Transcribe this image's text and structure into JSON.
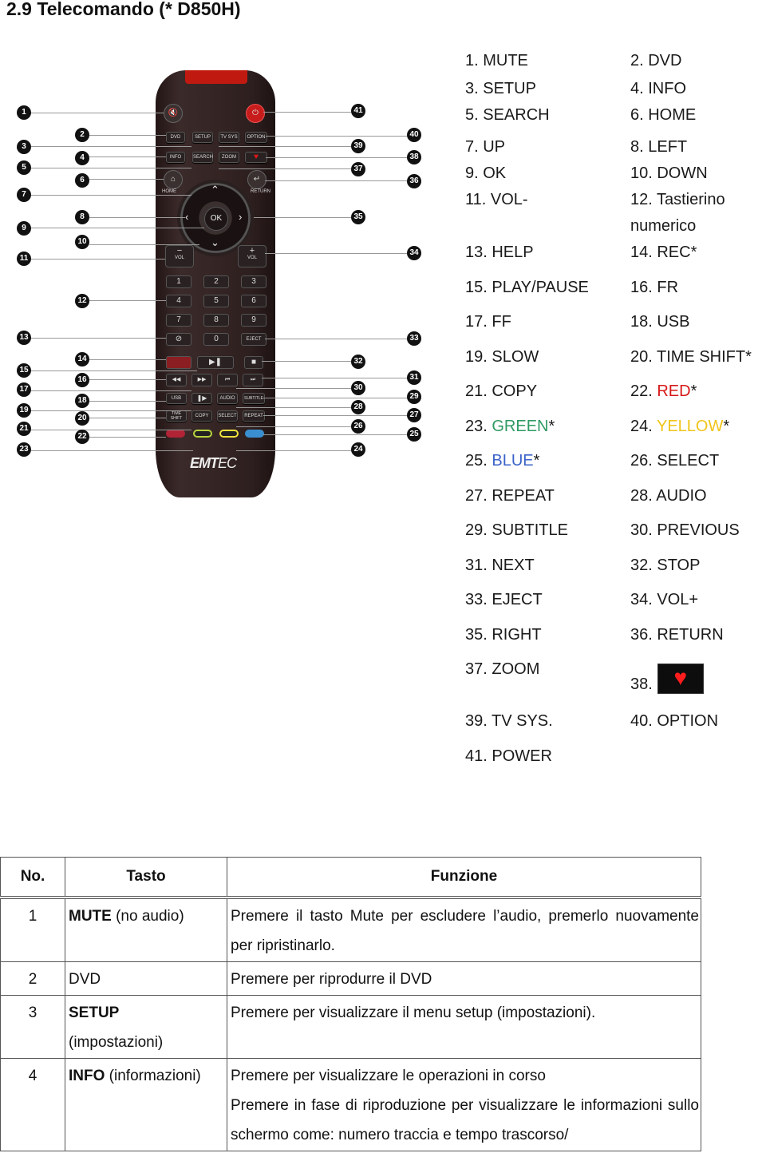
{
  "title": "2.9 Telecomando (* D850H)",
  "remote": {
    "brand": "EMT",
    "brand_suffix": "EC",
    "buttons": {
      "dvd": "DVD",
      "setup": "SETUP",
      "tvsys": "TV SYS",
      "option": "OPTION",
      "info": "INFO",
      "search": "SEARCH",
      "zoom": "ZOOM",
      "home": "HOME",
      "return": "RETURN",
      "ok": "OK",
      "vol_minus": "−",
      "vol_plus": "+",
      "vol": "VOL",
      "eject": "EJECT",
      "usb": "USB",
      "audio": "AUDIO",
      "subtitle": "SUBTITLE",
      "timeshift": "TIME SHIFT",
      "copy": "COPY",
      "select": "SELECT",
      "repeat": "REPEAT",
      "digits": [
        "1",
        "2",
        "3",
        "4",
        "5",
        "6",
        "7",
        "8",
        "9",
        "0"
      ]
    },
    "colors": {
      "red": "#c0283a",
      "green": "#b6d43c",
      "yellow": "#f2e23a",
      "blue": "#3a8fd0",
      "power": "#d81c1c"
    }
  },
  "legend": [
    {
      "left": "1. MUTE",
      "right": "2. DVD"
    },
    {
      "left": "3. SETUP",
      "right": "4. INFO"
    },
    {
      "left": "5. SEARCH",
      "right": "6. HOME"
    },
    {
      "left": "7. UP",
      "right": "8. LEFT"
    },
    {
      "left": "9. OK",
      "right": "10. DOWN"
    },
    {
      "left": "11. VOL-",
      "right": "12. Tastierino",
      "right2": "numerico"
    },
    {
      "left": "13. HELP",
      "right": "14. REC*"
    },
    {
      "left": "15. PLAY/PAUSE",
      "right": "16. FR"
    },
    {
      "left": "17. FF",
      "right": "18. USB"
    },
    {
      "left": "19. SLOW",
      "right": "20. TIME SHIFT*"
    },
    {
      "left": "21. COPY",
      "right_num": "22. ",
      "right_color": "RED",
      "right_star": "*"
    },
    {
      "left_num": "23. ",
      "left_color": "GREEN",
      "left_star": "*",
      "right_num": "24. ",
      "right_color": "YELLOW",
      "right_star": "*"
    },
    {
      "left_num": "25. ",
      "left_color": "BLUE",
      "left_star": "*",
      "right": "26. SELECT"
    },
    {
      "left": "27. REPEAT",
      "right": "28. AUDIO"
    },
    {
      "left": "29. SUBTITLE",
      "right": "30. PREVIOUS"
    },
    {
      "left": "31. NEXT",
      "right": "32. STOP"
    },
    {
      "left": "33. EJECT",
      "right": "34. VOL+"
    },
    {
      "left": "35. RIGHT",
      "right": "36. RETURN"
    },
    {
      "left": "37. ZOOM",
      "right": "38.",
      "right_icon": "heart-icon"
    },
    {
      "left": "39. TV SYS.",
      "right": "40. OPTION"
    },
    {
      "left": "41. POWER"
    }
  ],
  "table": {
    "headers": [
      "No.",
      "Tasto",
      "Funzione"
    ],
    "rows": [
      {
        "no": "1",
        "key_bold": "MUTE",
        "key_rest": " (no audio)",
        "fn": "Premere il tasto Mute per escludere l’audio, premerlo nuovamente per ripristinarlo."
      },
      {
        "no": "2",
        "key_bold": "",
        "key_rest": "DVD",
        "fn": "Premere per riprodurre il DVD"
      },
      {
        "no": "3",
        "key_bold": "SETUP",
        "key_rest": "(impostazioni)",
        "fn": "Premere per visualizzare il menu setup (impostazioni)."
      },
      {
        "no": "4",
        "key_bold": "INFO",
        "key_rest": " (informazioni)",
        "fn": "Premere per visualizzare le operazioni in corso",
        "fn2": "Premere in fase di riproduzione per visualizzare le informazioni sullo schermo come: numero traccia e tempo trascorso/"
      }
    ]
  }
}
